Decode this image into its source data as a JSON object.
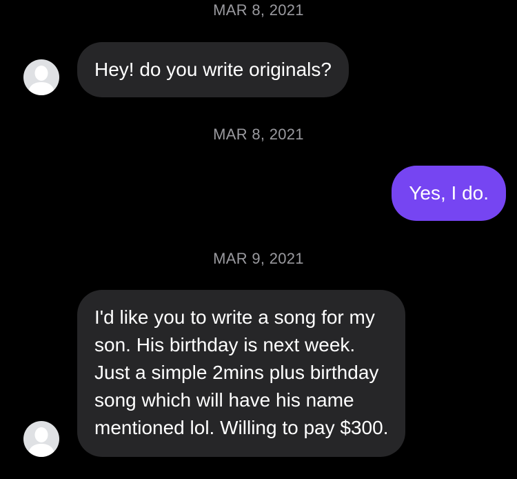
{
  "thread": {
    "dates": [
      {
        "label": "MAR 8, 2021"
      },
      {
        "label": "MAR 8, 2021"
      },
      {
        "label": "MAR 9, 2021"
      }
    ],
    "messages": [
      {
        "direction": "incoming",
        "lines": [
          "Hey! do you write originals?"
        ]
      },
      {
        "direction": "outgoing",
        "lines": [
          "Yes, I do."
        ]
      },
      {
        "direction": "incoming",
        "lines": [
          "I'd like you to write a song for my",
          "son. His birthday is next week.",
          "Just a simple 2mins plus birthday",
          "song which will have his name",
          "mentioned lol. Willing to pay $300."
        ]
      }
    ]
  },
  "colors": {
    "background": "#000000",
    "incoming_bubble": "#262628",
    "outgoing_bubble": "#7645f2",
    "date_text": "#9a9a9f",
    "avatar_bg": "#dfe1e4",
    "avatar_silhouette": "#ffffff"
  },
  "icons": {
    "avatar": "default-user-avatar-icon"
  }
}
